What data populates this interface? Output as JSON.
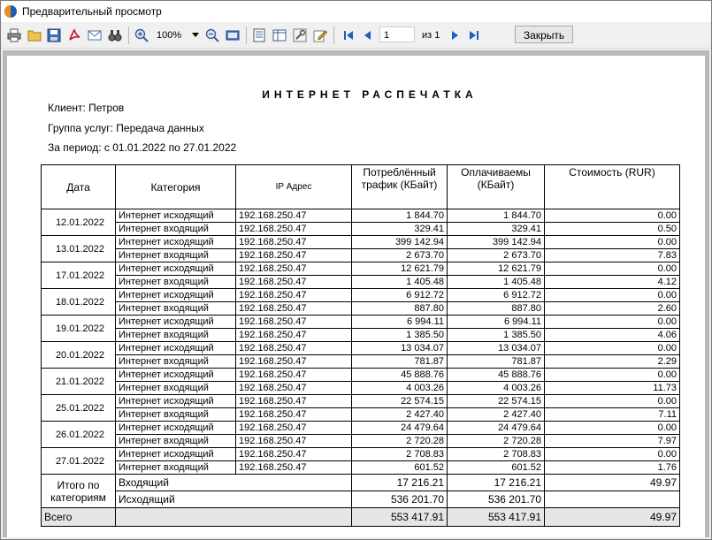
{
  "window": {
    "title": "Предварительный просмотр"
  },
  "toolbar": {
    "zoom": "100%",
    "page_current": "1",
    "page_of": "из 1",
    "close_label": "Закрыть"
  },
  "report": {
    "title": "ИНТЕРНЕТ  РАСПЕЧАТКА",
    "client": "Клиент: Петров",
    "service_group": "Группа услуг: Передача данных",
    "period": "За период: с 01.01.2022 по 27.01.2022",
    "headers": {
      "date": "Дата",
      "category": "Категория",
      "ip": "IP Адрес",
      "consumed": "Потреблённый трафик (КБайт)",
      "paid": "Оплачиваемы (КБайт)",
      "cost": "Стоимость (RUR)"
    },
    "days": [
      {
        "date": "12.01.2022",
        "rows": [
          {
            "category": "Интернет исходящий",
            "ip": "192.168.250.47",
            "consumed": "1 844.70",
            "paid": "1 844.70",
            "cost": "0.00"
          },
          {
            "category": "Интернет входящий",
            "ip": "192.168.250.47",
            "consumed": "329.41",
            "paid": "329.41",
            "cost": "0.50"
          }
        ]
      },
      {
        "date": "13.01.2022",
        "rows": [
          {
            "category": "Интернет исходящий",
            "ip": "192.168.250.47",
            "consumed": "399 142.94",
            "paid": "399 142.94",
            "cost": "0.00"
          },
          {
            "category": "Интернет входящий",
            "ip": "192.168.250.47",
            "consumed": "2 673.70",
            "paid": "2 673.70",
            "cost": "7.83"
          }
        ]
      },
      {
        "date": "17.01.2022",
        "rows": [
          {
            "category": "Интернет исходящий",
            "ip": "192.168.250.47",
            "consumed": "12 621.79",
            "paid": "12 621.79",
            "cost": "0.00"
          },
          {
            "category": "Интернет входящий",
            "ip": "192.168.250.47",
            "consumed": "1 405.48",
            "paid": "1 405.48",
            "cost": "4.12"
          }
        ]
      },
      {
        "date": "18.01.2022",
        "rows": [
          {
            "category": "Интернет исходящий",
            "ip": "192.168.250.47",
            "consumed": "6 912.72",
            "paid": "6 912.72",
            "cost": "0.00"
          },
          {
            "category": "Интернет входящий",
            "ip": "192.168.250.47",
            "consumed": "887.80",
            "paid": "887.80",
            "cost": "2.60"
          }
        ]
      },
      {
        "date": "19.01.2022",
        "rows": [
          {
            "category": "Интернет исходящий",
            "ip": "192.168.250.47",
            "consumed": "6 994.11",
            "paid": "6 994.11",
            "cost": "0.00"
          },
          {
            "category": "Интернет входящий",
            "ip": "192.168.250.47",
            "consumed": "1 385.50",
            "paid": "1 385.50",
            "cost": "4.06"
          }
        ]
      },
      {
        "date": "20.01.2022",
        "rows": [
          {
            "category": "Интернет исходящий",
            "ip": "192.168.250.47",
            "consumed": "13 034.07",
            "paid": "13 034.07",
            "cost": "0.00"
          },
          {
            "category": "Интернет входящий",
            "ip": "192.168.250.47",
            "consumed": "781.87",
            "paid": "781.87",
            "cost": "2.29"
          }
        ]
      },
      {
        "date": "21.01.2022",
        "rows": [
          {
            "category": "Интернет исходящий",
            "ip": "192.168.250.47",
            "consumed": "45 888.76",
            "paid": "45 888.76",
            "cost": "0.00"
          },
          {
            "category": "Интернет входящий",
            "ip": "192.168.250.47",
            "consumed": "4 003.26",
            "paid": "4 003.26",
            "cost": "11.73"
          }
        ]
      },
      {
        "date": "25.01.2022",
        "rows": [
          {
            "category": "Интернет исходящий",
            "ip": "192.168.250.47",
            "consumed": "22 574.15",
            "paid": "22 574.15",
            "cost": "0.00"
          },
          {
            "category": "Интернет входящий",
            "ip": "192.168.250.47",
            "consumed": "2 427.40",
            "paid": "2 427.40",
            "cost": "7.11"
          }
        ]
      },
      {
        "date": "26.01.2022",
        "rows": [
          {
            "category": "Интернет исходящий",
            "ip": "192.168.250.47",
            "consumed": "24 479.64",
            "paid": "24 479.64",
            "cost": "0.00"
          },
          {
            "category": "Интернет входящий",
            "ip": "192.168.250.47",
            "consumed": "2 720.28",
            "paid": "2 720.28",
            "cost": "7.97"
          }
        ]
      },
      {
        "date": "27.01.2022",
        "rows": [
          {
            "category": "Интернет исходящий",
            "ip": "192.168.250.47",
            "consumed": "2 708.83",
            "paid": "2 708.83",
            "cost": "0.00"
          },
          {
            "category": "Интернет входящий",
            "ip": "192.168.250.47",
            "consumed": "601.52",
            "paid": "601.52",
            "cost": "1.76"
          }
        ]
      }
    ],
    "summary": {
      "label": "Итого по категориям",
      "rows": [
        {
          "category": "Входящий",
          "consumed": "17 216.21",
          "paid": "17 216.21",
          "cost": "49.97"
        },
        {
          "category": "Исходящий",
          "consumed": "536 201.70",
          "paid": "536 201.70",
          "cost": ""
        }
      ]
    },
    "total": {
      "label": "Всего",
      "consumed": "553 417.91",
      "paid": "553 417.91",
      "cost": "49.97"
    }
  }
}
